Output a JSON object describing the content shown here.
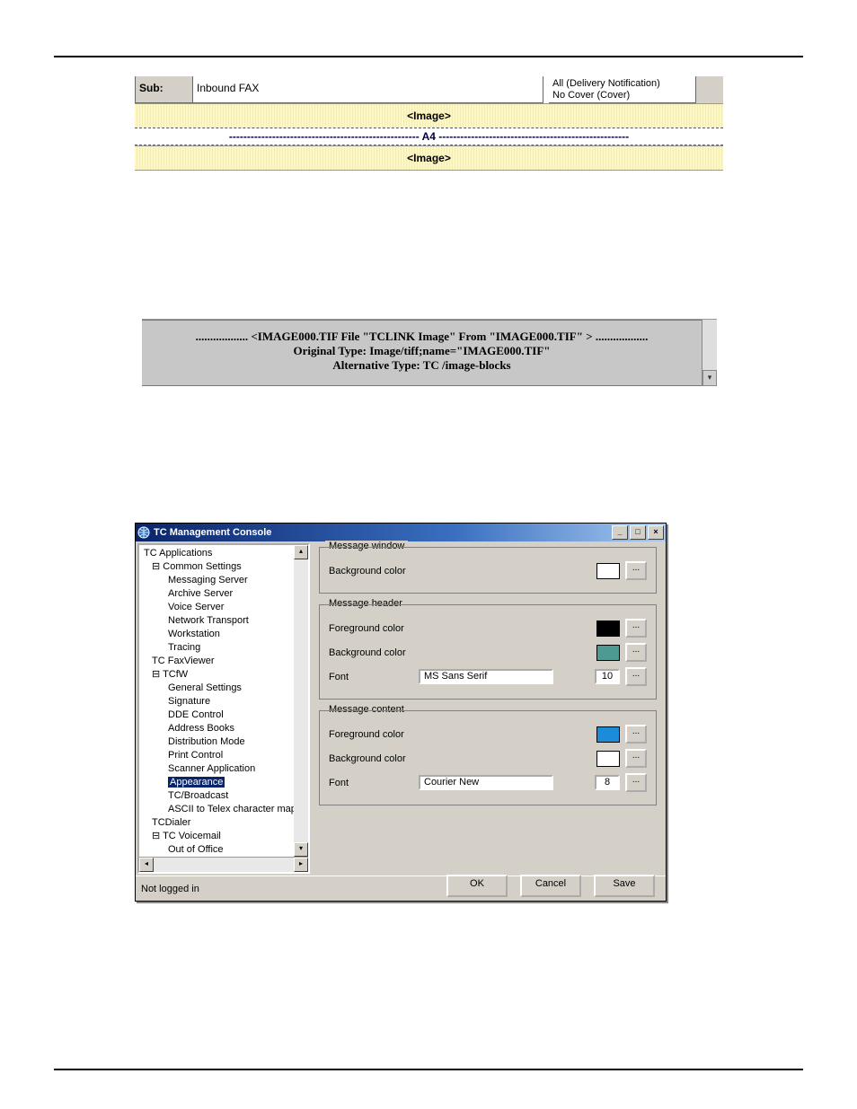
{
  "fig1": {
    "sub_label": "Sub:",
    "sub_value": "Inbound FAX",
    "opt1": "All   (Delivery Notification)",
    "opt2": "No Cover   (Cover)",
    "image_tag": "<Image>",
    "a4": "----------------------------------------------------- A4 -----------------------------------------------------"
  },
  "fig2": {
    "line1": "..................  <IMAGE000.TIF File \"TCLINK Image\" From \"IMAGE000.TIF\" >  ..................",
    "line2": "Original Type: Image/tiff;name=\"IMAGE000.TIF\"",
    "line3": "Alternative Type: TC /image-blocks"
  },
  "console": {
    "title": "TC Management Console",
    "status": "Not logged in",
    "ellipsis": "...",
    "buttons": {
      "ok": "OK",
      "cancel": "Cancel",
      "save": "Save"
    },
    "labels": {
      "bg": "Background color",
      "fg": "Foreground color",
      "font": "Font"
    },
    "tree": [
      "TC Applications",
      "⊟ Common Settings",
      "Messaging Server",
      "Archive Server",
      "Voice Server",
      "Network Transport",
      "Workstation",
      "Tracing",
      "TC FaxViewer",
      "⊟ TCfW",
      "General Settings",
      "Signature",
      "DDE Control",
      "Address Books",
      "Distribution Mode",
      "Print Control",
      "Scanner Application",
      "Appearance",
      "TC/Broadcast",
      "ASCII to Telex character mappin",
      "TCDialer",
      "⊟ TC Voicemail",
      "Out of Office"
    ],
    "groups": [
      {
        "title": "Message window",
        "bg_style": "background:#ffffff"
      },
      {
        "title": "Message header",
        "fg_style": "background:#000000",
        "bg_style": "background:#4d9a93",
        "font": "MS Sans Serif",
        "size": "10"
      },
      {
        "title": "Message content",
        "fg_style": "background:#1a8cd8",
        "bg_style": "background:#ffffff",
        "font": "Courier New",
        "size": "8"
      }
    ]
  }
}
